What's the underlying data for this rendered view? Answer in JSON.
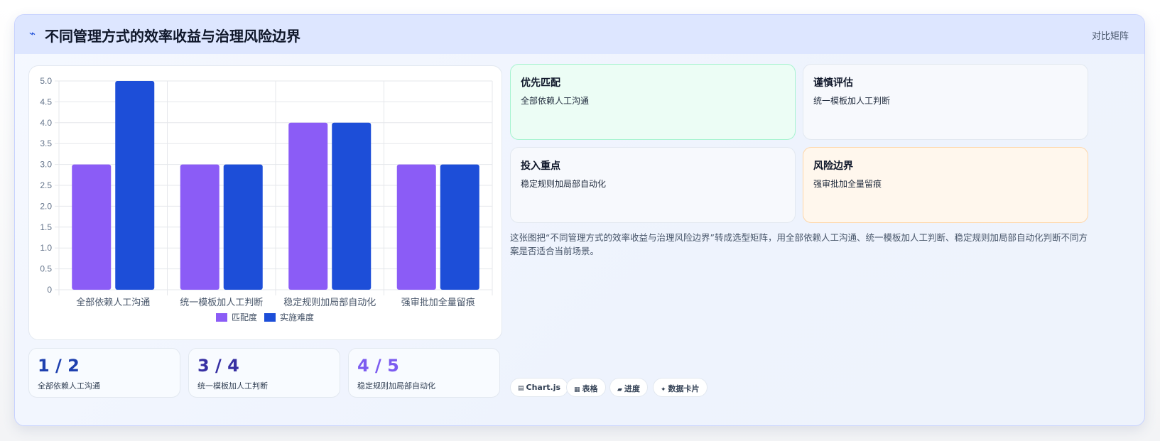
{
  "header": {
    "icon": "⌁",
    "title": "不同管理方式的效率收益与治理风险边界",
    "tag": "对比矩阵"
  },
  "chart_data": {
    "type": "bar",
    "categories": [
      "全部依赖人工沟通",
      "统一模板加人工判断",
      "稳定规则加局部自动化",
      "强审批加全量留痕"
    ],
    "series": [
      {
        "name": "匹配度",
        "values": [
          3,
          3,
          4,
          3
        ],
        "color": "#8b5cf6"
      },
      {
        "name": "实施难度",
        "values": [
          5,
          3,
          4,
          3
        ],
        "color": "#1d4ed8"
      }
    ],
    "yticks": [
      "0",
      "0.5",
      "1.0",
      "1.5",
      "2.0",
      "2.5",
      "3.0",
      "3.5",
      "4.0",
      "4.5",
      "5.0"
    ],
    "ylim": [
      0,
      5
    ],
    "grid": true,
    "legend": "bottom"
  },
  "kpis": [
    {
      "value": "1 / 2",
      "label": "全部依赖人工沟通",
      "color": "#1e40af"
    },
    {
      "value": "3 / 4",
      "label": "统一模板加人工判断",
      "color": "#3730a3"
    },
    {
      "value": "4 / 5",
      "label": "稳定规则加局部自动化",
      "color": "#7c5cf0"
    }
  ],
  "matrix": [
    {
      "title": "优先匹配",
      "text": "全部依赖人工沟通",
      "bg": "#ecfdf5",
      "border": "#a7f3d0"
    },
    {
      "title": "谨慎评估",
      "text": "统一模板加人工判断",
      "bg": "#f7f9fd",
      "border": "#e2e8f0"
    },
    {
      "title": "投入重点",
      "text": "稳定规则加局部自动化",
      "bg": "#f7f9fd",
      "border": "#e2e8f0"
    },
    {
      "title": "风险边界",
      "text": "强审批加全量留痕",
      "bg": "#fff7ed",
      "border": "#fed7aa"
    }
  ],
  "description": "这张图把“不同管理方式的效率收益与治理风险边界”转成选型矩阵，用全部依赖人工沟通、统一模板加人工判断、稳定规则加局部自动化判断不同方案是否适合当前场景。",
  "pills": [
    {
      "icon": "▤",
      "label": "Chart.js"
    },
    {
      "icon": "▦",
      "label": "表格"
    },
    {
      "icon": "▰",
      "label": "进度"
    },
    {
      "icon": "✦",
      "label": "数据卡片"
    }
  ]
}
